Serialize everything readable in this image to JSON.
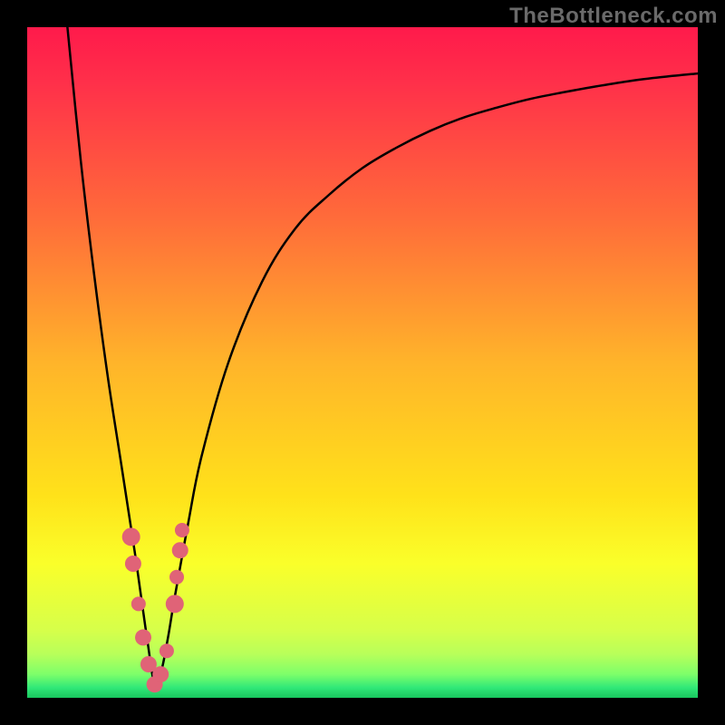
{
  "watermark": "TheBottleneck.com",
  "chart_data": {
    "type": "line",
    "title": "",
    "xlabel": "",
    "ylabel": "",
    "xlim": [
      0,
      100
    ],
    "ylim": [
      0,
      100
    ],
    "x_optimum": 19,
    "gradient_stops": [
      {
        "offset": 0,
        "color": "#ff1a4b"
      },
      {
        "offset": 0.08,
        "color": "#ff2f4a"
      },
      {
        "offset": 0.28,
        "color": "#ff6a3a"
      },
      {
        "offset": 0.5,
        "color": "#ffb42a"
      },
      {
        "offset": 0.7,
        "color": "#ffe21a"
      },
      {
        "offset": 0.8,
        "color": "#faff2a"
      },
      {
        "offset": 0.9,
        "color": "#d6ff4a"
      },
      {
        "offset": 0.935,
        "color": "#b8ff5a"
      },
      {
        "offset": 0.965,
        "color": "#7dff6a"
      },
      {
        "offset": 0.985,
        "color": "#30e878"
      },
      {
        "offset": 1.0,
        "color": "#18c85e"
      }
    ],
    "series": [
      {
        "name": "bottleneck-curve",
        "x": [
          6,
          8,
          10,
          12,
          14,
          16,
          17,
          18,
          19,
          20,
          21,
          22,
          24,
          26,
          30,
          35,
          40,
          45,
          50,
          55,
          60,
          65,
          70,
          75,
          80,
          85,
          90,
          95,
          100
        ],
        "values": [
          100,
          80,
          63,
          48,
          35,
          22,
          15,
          8,
          2,
          4,
          9,
          15,
          26,
          36,
          50,
          62,
          70,
          75,
          79,
          82,
          84.5,
          86.5,
          88,
          89.3,
          90.3,
          91.2,
          92,
          92.6,
          93.1
        ]
      }
    ],
    "markers": {
      "name": "sample-dots",
      "color": "#e06377",
      "points": [
        {
          "x": 15.5,
          "y": 24,
          "r": 10
        },
        {
          "x": 15.8,
          "y": 20,
          "r": 9
        },
        {
          "x": 16.6,
          "y": 14,
          "r": 8
        },
        {
          "x": 17.3,
          "y": 9,
          "r": 9
        },
        {
          "x": 18.1,
          "y": 5,
          "r": 9
        },
        {
          "x": 19.0,
          "y": 2,
          "r": 9
        },
        {
          "x": 19.9,
          "y": 3.5,
          "r": 9
        },
        {
          "x": 20.8,
          "y": 7,
          "r": 8
        },
        {
          "x": 22.0,
          "y": 14,
          "r": 10
        },
        {
          "x": 22.3,
          "y": 18,
          "r": 8
        },
        {
          "x": 22.8,
          "y": 22,
          "r": 9
        },
        {
          "x": 23.1,
          "y": 25,
          "r": 8
        }
      ]
    }
  }
}
